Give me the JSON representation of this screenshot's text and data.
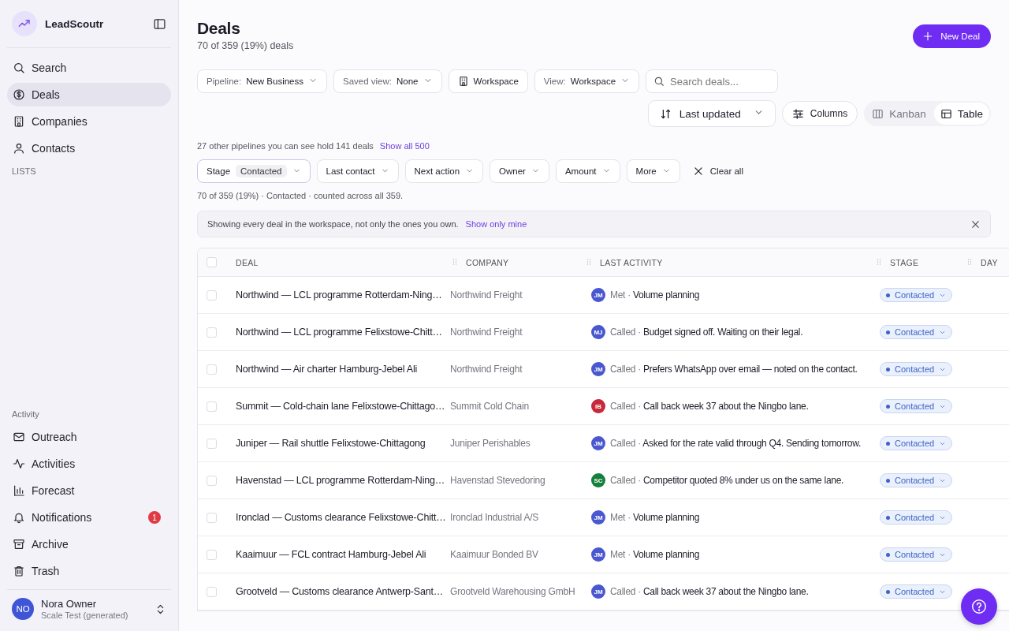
{
  "sidebar": {
    "brand": "LeadScoutr",
    "nav_items": [
      {
        "label": "Search",
        "selected": false
      },
      {
        "label": "Deals",
        "selected": true
      },
      {
        "label": "Companies",
        "selected": false
      },
      {
        "label": "Contacts",
        "selected": false
      }
    ],
    "lists_heading": "LISTS",
    "activity_heading": "Activity",
    "activity_items": [
      {
        "label": "Outreach"
      },
      {
        "label": "Activities"
      },
      {
        "label": "Forecast"
      },
      {
        "label": "Notifications",
        "badge": "1"
      },
      {
        "label": "Archive"
      },
      {
        "label": "Trash"
      }
    ],
    "user": {
      "initials": "NO",
      "name": "Nora Owner",
      "workspace": "Scale Test (generated)"
    }
  },
  "header": {
    "title": "Deals",
    "subtitle": "70 of 359 (19%) deals",
    "new_button": "New Deal"
  },
  "toolbar": {
    "pipeline": {
      "label": "Pipeline:",
      "value": "New Business"
    },
    "saved_view": {
      "label": "Saved view:",
      "value": "None"
    },
    "scope_button": "Workspace",
    "view": {
      "label": "View:",
      "value": "Workspace"
    },
    "search": {
      "placeholder": "Search deals..."
    },
    "sort": "Last updated",
    "columns_button": "Columns",
    "view_toggle": [
      {
        "label": "Kanban",
        "selected": false
      },
      {
        "label": "Table",
        "selected": true
      }
    ]
  },
  "other_pipelines": {
    "text": "27 other pipelines you can see hold 141 deals",
    "link": "Show all 500"
  },
  "filters": [
    {
      "label": "Stage",
      "value": "Contacted",
      "active": true
    },
    {
      "label": "Last contact",
      "active": false
    },
    {
      "label": "Next action",
      "active": false
    },
    {
      "label": "Owner",
      "active": false
    },
    {
      "label": "Amount",
      "active": false
    },
    {
      "label": "More",
      "active": false
    }
  ],
  "clear_all": "Clear all",
  "count_text": "70 of 359 (19%) · Contacted · counted across all 359.",
  "banner": {
    "text": "Showing every deal in the workspace, not only the ones you own.",
    "link": "Show only mine"
  },
  "table": {
    "all_checked": false,
    "columns": [
      "DEAL",
      "COMPANY",
      "LAST ACTIVITY",
      "STAGE",
      "DAY"
    ],
    "rows": [
      {
        "checked": false,
        "deal": "Northwind — LCL programme Rotterdam-Ning…",
        "company": "Northwind Freight",
        "activity": {
          "initials": "JM",
          "color": "#4a58d0",
          "verb": "Met ·",
          "note": "Volume planning"
        },
        "stage": "Contacted"
      },
      {
        "checked": false,
        "deal": "Northwind — LCL programme Felixstowe-Chitt…",
        "company": "Northwind Freight",
        "activity": {
          "initials": "MJ",
          "color": "#4a58d0",
          "verb": "Called ·",
          "note": "Budget signed off. Waiting on their legal."
        },
        "stage": "Contacted"
      },
      {
        "checked": false,
        "deal": "Northwind — Air charter Hamburg-Jebel Ali",
        "company": "Northwind Freight",
        "activity": {
          "initials": "JM",
          "color": "#4a58d0",
          "verb": "Called ·",
          "note": "Prefers WhatsApp over email — noted on the contact."
        },
        "stage": "Contacted"
      },
      {
        "checked": false,
        "deal": "Summit — Cold-chain lane Felixstowe-Chittago…",
        "company": "Summit Cold Chain",
        "activity": {
          "initials": "IB",
          "color": "#c8283a",
          "verb": "Called ·",
          "note": "Call back week 37 about the Ningbo lane."
        },
        "stage": "Contacted"
      },
      {
        "checked": false,
        "deal": "Juniper — Rail shuttle Felixstowe-Chittagong",
        "company": "Juniper Perishables",
        "activity": {
          "initials": "JM",
          "color": "#4a58d0",
          "verb": "Called ·",
          "note": "Asked for the rate valid through Q4. Sending tomorrow."
        },
        "stage": "Contacted"
      },
      {
        "checked": false,
        "deal": "Havenstad — LCL programme Rotterdam-Ning…",
        "company": "Havenstad Stevedoring",
        "activity": {
          "initials": "SC",
          "color": "#15803d",
          "verb": "Called ·",
          "note": "Competitor quoted 8% under us on the same lane."
        },
        "stage": "Contacted"
      },
      {
        "checked": false,
        "deal": "Ironclad — Customs clearance Felixstowe-Chitt…",
        "company": "Ironclad Industrial A/S",
        "activity": {
          "initials": "JM",
          "color": "#4a58d0",
          "verb": "Met ·",
          "note": "Volume planning"
        },
        "stage": "Contacted"
      },
      {
        "checked": false,
        "deal": "Kaaimuur — FCL contract Hamburg-Jebel Ali",
        "company": "Kaaimuur Bonded BV",
        "activity": {
          "initials": "JM",
          "color": "#4a58d0",
          "verb": "Met ·",
          "note": "Volume planning"
        },
        "stage": "Contacted"
      },
      {
        "checked": false,
        "deal": "Grootveld — Customs clearance Antwerp-Sant…",
        "company": "Grootveld Warehousing GmbH",
        "activity": {
          "initials": "JM",
          "color": "#4a58d0",
          "verb": "Called ·",
          "note": "Call back week 37 about the Ningbo lane."
        },
        "stage": "Contacted"
      }
    ]
  }
}
